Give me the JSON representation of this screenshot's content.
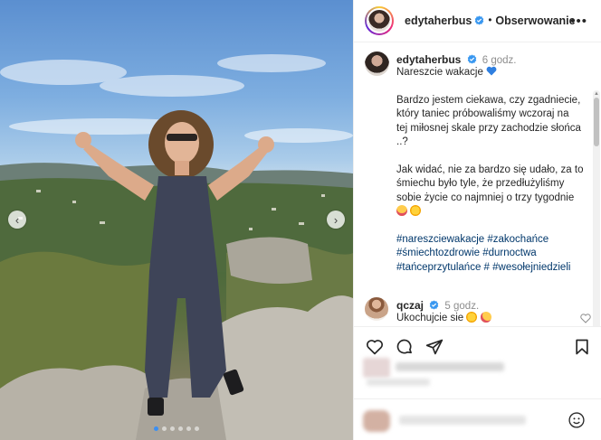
{
  "header": {
    "username": "edytaherbus",
    "separator": "•",
    "follow_label": "Obserwowanie",
    "more_label": "•••"
  },
  "post": {
    "username": "edytaherbus",
    "time": "6 godz.",
    "line1": "Nareszcie wakacje",
    "para2": [
      "Bardzo jestem ciekawa, czy zgadniecie,",
      "który taniec próbowaliśmy wczoraj na",
      "tej miłosnej skale przy zachodzie słońca",
      "..?"
    ],
    "para3": [
      "Jak widać, nie za bardzo się udało, za to",
      "śmiechu było tyle, że przedłużyliśmy",
      "sobie życie co najmniej o trzy tygodnie"
    ],
    "hashtags": [
      "#nareszciewakacje #zakochańce",
      "#śmiechtozdrowie #durnoctwa",
      "#tańceprzytulańce # #wesołejniedzieli"
    ]
  },
  "comment": {
    "username": "qczaj",
    "time": "5 godz.",
    "text": "Ukochujcie sie"
  },
  "icons": {
    "verified": "verified-badge-icon",
    "like": "heart-icon",
    "comment": "comment-icon",
    "share": "share-icon",
    "save": "bookmark-icon",
    "emoji": "emoji-icon",
    "prev": "chevron-left-icon",
    "next": "chevron-right-icon"
  },
  "carousel": {
    "prev_glyph": "‹",
    "next_glyph": "›",
    "slide_count": 6,
    "active_slide": 1
  },
  "colors": {
    "verified": "#3897f0",
    "link": "#00376b",
    "muted": "#8e8e8e",
    "text": "#262626"
  }
}
